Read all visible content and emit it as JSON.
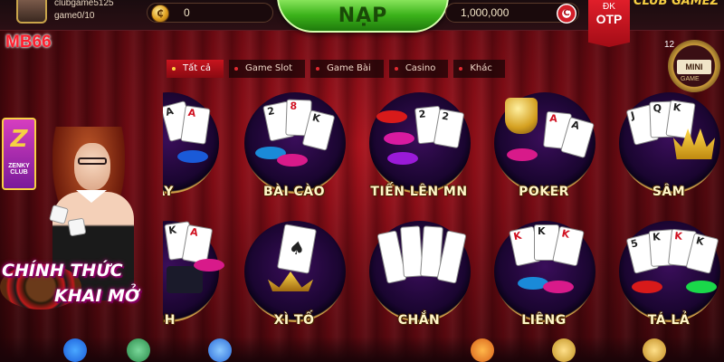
{
  "header": {
    "username": "clubgame5125",
    "game_count": "game0/10",
    "coin_symbol": "₵",
    "coin_value": "0",
    "nap_label": "NẠP",
    "balance": "1,000,000",
    "balance_chip_symbol": "C",
    "otp_line1": "ĐK",
    "otp_line2": "OTP",
    "club_text": "CLUB GAMEZ"
  },
  "brand": {
    "watermark": "MB66"
  },
  "mini_game": {
    "badge": "12",
    "label": "MINI",
    "sub": "GAME"
  },
  "tabs": [
    {
      "label": "Tất cả",
      "active": true
    },
    {
      "label": "Game Slot",
      "active": false
    },
    {
      "label": "Game Bài",
      "active": false
    },
    {
      "label": "Casino",
      "active": false
    },
    {
      "label": "Khác",
      "active": false
    }
  ],
  "promo": {
    "logo_letter": "Z",
    "logo_sub": "ZENKY CLUB",
    "line1": "CHÍNH THỨC",
    "line2": "KHAI MỞ"
  },
  "games": [
    {
      "label": "CÂY",
      "icon": "cards-chips-icon"
    },
    {
      "label": "BÀI CÀO",
      "icon": "cards-chips-icon"
    },
    {
      "label": "TIẾN LÊN MN",
      "icon": "cards-chips-icon"
    },
    {
      "label": "POKER",
      "icon": "trophy-cards-icon"
    },
    {
      "label": "SÂM",
      "icon": "crown-cards-icon"
    },
    {
      "label": "INH",
      "icon": "hat-cards-icon"
    },
    {
      "label": "XÌ TỐ",
      "icon": "ace-spade-icon"
    },
    {
      "label": "CHẮN",
      "icon": "chan-cards-icon"
    },
    {
      "label": "LIÊNG",
      "icon": "cards-chips-icon"
    },
    {
      "label": "TÁ LẢ",
      "icon": "cards-chips-icon"
    }
  ],
  "colors": {
    "accent_red": "#c8141e",
    "nap_green": "#3bb21a",
    "gold": "#d4a44a"
  }
}
